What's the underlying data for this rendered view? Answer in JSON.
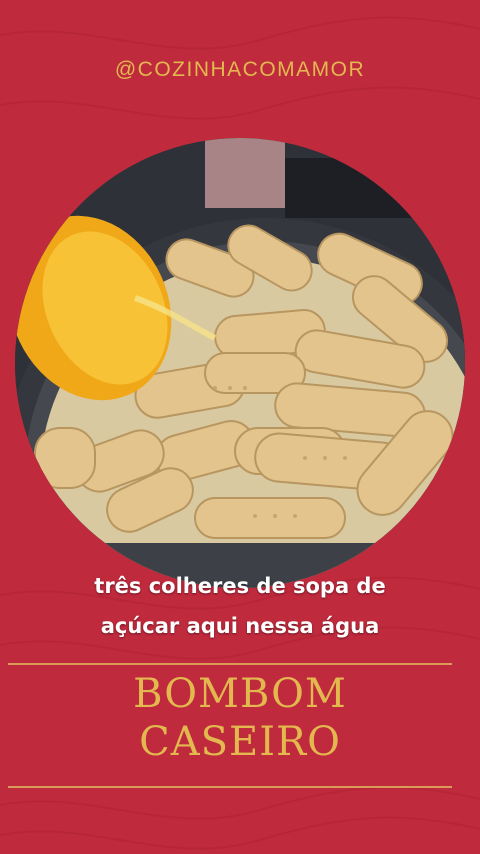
{
  "header": {
    "handle": "@COZINHACOMAMOR"
  },
  "photo": {
    "subject": "biscuits-in-pan-with-orange"
  },
  "caption": {
    "line1": "três colheres de sopa de",
    "line2": "açúcar aqui nessa água"
  },
  "title": {
    "line1": "BOMBOM",
    "line2": "CASEIRO"
  },
  "colors": {
    "background": "#c02a3d",
    "accent_gold": "#e2b84f",
    "rule": "#d99a5a",
    "caption_text": "#ffffff"
  }
}
